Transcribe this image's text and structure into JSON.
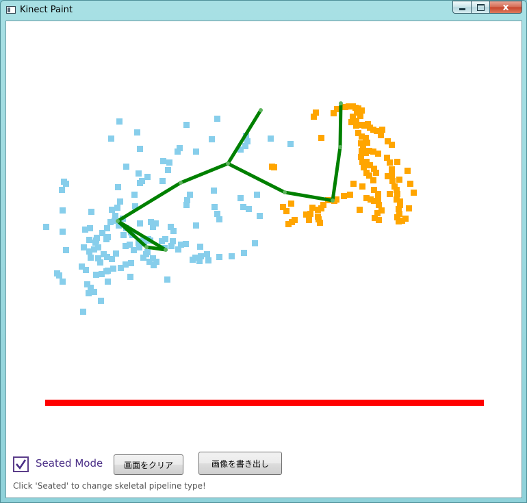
{
  "window": {
    "title": "Kinect Paint",
    "icon": "app-window-icon",
    "controls": {
      "minimize": "minimize-icon",
      "maximize": "maximize-icon",
      "close_glyph": "x"
    }
  },
  "canvas": {
    "colors": {
      "left_points": "#87ceeb",
      "right_points": "#ffa500",
      "skeleton": "#008000",
      "floor_line": "#ff0000",
      "background": "#ffffff"
    }
  },
  "controls": {
    "seated_mode": {
      "label": "Seated Mode",
      "checked": true
    },
    "clear_button": "画面をクリア",
    "export_button": "画像を書き出し",
    "hint": "Click 'Seated' to change skeletal pipeline type!"
  }
}
